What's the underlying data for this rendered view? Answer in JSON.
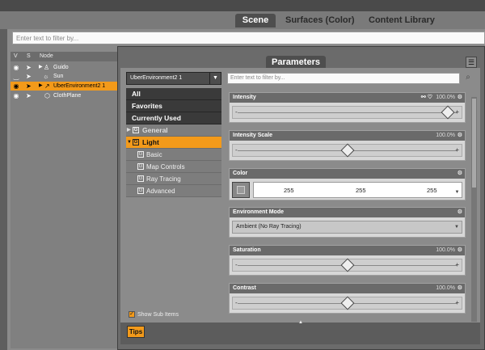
{
  "tabs": [
    "Scene",
    "Surfaces (Color)",
    "Content Library"
  ],
  "scene": {
    "filter_placeholder": "Enter text to filter by...",
    "columns": [
      "V",
      "S",
      "Node"
    ],
    "nodes": [
      {
        "label": "Guido",
        "selected": false
      },
      {
        "label": "Sun",
        "selected": false
      },
      {
        "label": "UberEnvironment2 1",
        "selected": true
      },
      {
        "label": "ClothPlane",
        "selected": false
      }
    ]
  },
  "parameters": {
    "tab_label": "Parameters",
    "node_select": "UberEnvironment2 1",
    "filter_placeholder": "Enter text to filter by...",
    "categories": {
      "all": "All",
      "favorites": "Favorites",
      "currently_used": "Currently Used",
      "general": "General",
      "light": "Light",
      "basic": "Basic",
      "map_controls": "Map Controls",
      "ray_tracing": "Ray Tracing",
      "advanced": "Advanced"
    },
    "show_sub_items": "Show Sub Items",
    "tips": "Tips",
    "props": {
      "intensity": {
        "label": "Intensity",
        "value": "100.0%",
        "fraction": 0.98
      },
      "intensity_scale": {
        "label": "Intensity Scale",
        "value": "100.0%",
        "fraction": 0.5
      },
      "color": {
        "label": "Color",
        "r": "255",
        "g": "255",
        "b": "255"
      },
      "environment_mode": {
        "label": "Environment Mode",
        "value": "Ambient (No Ray Tracing)"
      },
      "saturation": {
        "label": "Saturation",
        "value": "100.0%",
        "fraction": 0.5
      },
      "contrast": {
        "label": "Contrast",
        "value": "100.0%",
        "fraction": 0.5
      }
    }
  },
  "colors": {
    "accent": "#f39a1a",
    "panel_dark": "#4e4e4e"
  }
}
